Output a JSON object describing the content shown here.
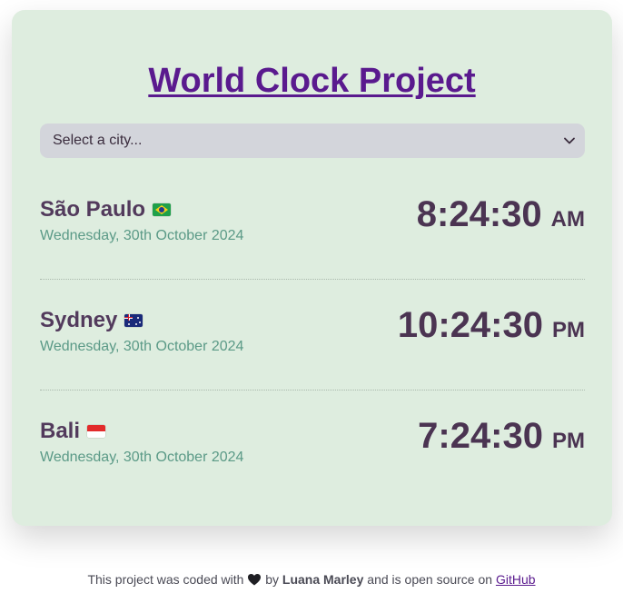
{
  "title": "World Clock Project",
  "select": {
    "placeholder": "Select a city..."
  },
  "cities": [
    {
      "name": "São Paulo",
      "flag": "brazil-flag",
      "date": "Wednesday, 30th October 2024",
      "time": "8:24:30",
      "ampm": "AM"
    },
    {
      "name": "Sydney",
      "flag": "australia-flag",
      "date": "Wednesday, 30th October 2024",
      "time": "10:24:30",
      "ampm": "PM"
    },
    {
      "name": "Bali",
      "flag": "indonesia-flag",
      "date": "Wednesday, 30th October 2024",
      "time": "7:24:30",
      "ampm": "PM"
    }
  ],
  "footer": {
    "prefix": "This project was coded with",
    "by": "by",
    "author": "Luana Marley",
    "middle": "and is open source on",
    "link": "GitHub",
    "heart_icon": "black-heart-icon"
  },
  "colors": {
    "card_bg": "#deeddf",
    "title": "#5a1a8e",
    "city_name": "#523a5c",
    "date": "#5b9a87",
    "time": "#4b3452",
    "select_bg": "#d3d5db"
  }
}
